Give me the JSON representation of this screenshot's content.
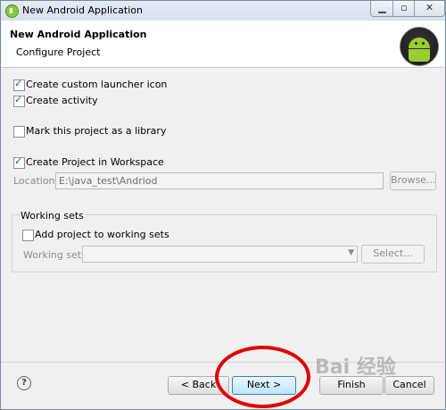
{
  "window": {
    "title": "New Android Application",
    "min_icon": "minimize-icon",
    "max_icon": "maximize-icon",
    "close_icon": "close-icon"
  },
  "header": {
    "title": "New Android Application",
    "subtitle": "Configure Project",
    "logo": "android-icon"
  },
  "options": {
    "launcher_icon": {
      "label": "Create custom launcher icon",
      "checked": true
    },
    "create_activity": {
      "label": "Create activity",
      "checked": true
    },
    "library": {
      "label": "Mark this project as a library",
      "checked": false
    },
    "workspace": {
      "label": "Create Project in Workspace",
      "checked": true
    }
  },
  "location": {
    "label": "Location:",
    "value": "E:\\java_test\\Andriod",
    "browse_label": "Browse..."
  },
  "working_sets": {
    "group_label": "Working sets",
    "add_label": "Add project to working sets",
    "add_checked": false,
    "sets_label": "Working sets:",
    "sets_value": "",
    "select_label": "Select..."
  },
  "footer": {
    "help_icon": "help-icon",
    "back_label": "< Back",
    "next_label": "Next >",
    "finish_label": "Finish",
    "cancel_label": "Cancel"
  },
  "annotation": {
    "color": "#e00000"
  },
  "watermark": {
    "text": "Bai 经验"
  }
}
